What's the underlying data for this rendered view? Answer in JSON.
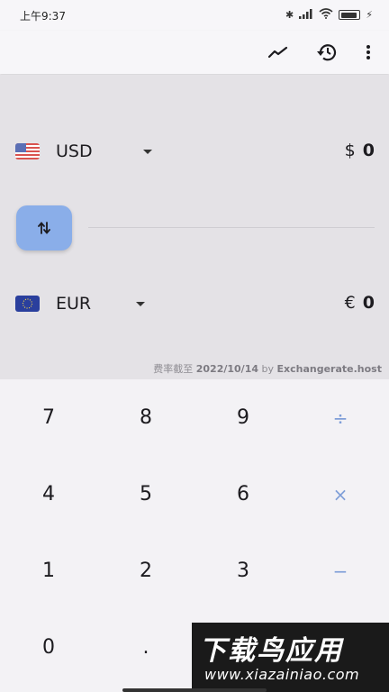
{
  "status_bar": {
    "time": "上午9:37",
    "icons": [
      "bluetooth-icon",
      "signal-icon",
      "wifi-icon",
      "battery-icon",
      "charging-icon"
    ]
  },
  "app_bar": {
    "icons": [
      "trend-chart-icon",
      "history-icon",
      "more-vert-icon"
    ]
  },
  "from": {
    "flag": "us-flag-icon",
    "code": "USD",
    "symbol": "$",
    "amount": "0"
  },
  "to": {
    "flag": "eu-flag-icon",
    "code": "EUR",
    "symbol": "€",
    "amount": "0"
  },
  "swap": {
    "icon": "swap-vert-icon",
    "color": "#8aaee9"
  },
  "rate_note": {
    "prefix": "费率截至",
    "date": "2022/10/14",
    "by": "by",
    "source": "Exchangerate.host"
  },
  "keypad": {
    "keys": [
      "7",
      "8",
      "9",
      "÷",
      "4",
      "5",
      "6",
      "×",
      "1",
      "2",
      "3",
      "−",
      "0",
      "."
    ],
    "operator_color": "#7f9fd8"
  },
  "watermark": {
    "main": "下载鸟应用",
    "sub": "www.xiazainiao.com"
  }
}
